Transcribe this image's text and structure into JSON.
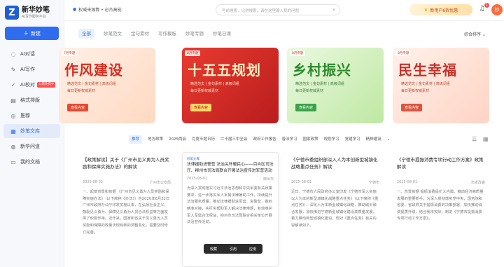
{
  "app": {
    "logo_mark": "Z",
    "title": "新华妙笔",
    "subtitle": "AI写作服务平台"
  },
  "sidebar": {
    "new_button": "新建",
    "items": [
      {
        "label": "AI对话",
        "icon": "chat-icon"
      },
      {
        "label": "AI写作",
        "icon": "pen-icon"
      },
      {
        "label": "AI校对",
        "icon": "proofread-icon",
        "badge": "公测免费中"
      },
      {
        "label": "格式排版",
        "icon": "format-icon"
      },
      {
        "label": "推荐",
        "icon": "recommend-icon"
      },
      {
        "label": "妙笔文库",
        "icon": "library-icon",
        "active": true
      },
      {
        "label": "新华问道",
        "icon": "ask-icon"
      },
      {
        "label": "我的文档",
        "icon": "document-icon"
      }
    ]
  },
  "topbar": {
    "tagline": "权威来源算 • 必杰高能",
    "search_placeholder": "写前搜索，记得搜索，请在这里输入我的问题",
    "promo": "新用户6折优惠",
    "notification_count": "1",
    "avatar_text": "妙"
  },
  "tabs": {
    "items": [
      "全部",
      "妙笔范文",
      "金句素材",
      "写作模板",
      "妙笔专题",
      "妙笔日课"
    ],
    "active": 0,
    "sort_label": "综合排序"
  },
  "banners": [
    {
      "tag": "7月专题",
      "title": "作风建设",
      "line1": "精选范文 | 金句素材 | 高级词组",
      "line2": "每日更新权威素材",
      "button": "查看内容"
    },
    {
      "tag": "8月专题",
      "title": "十五五规划",
      "line1": "精选范文 | 金句素材 | 高级词组",
      "line2": "每日更新权威素材",
      "button": "查看内容"
    },
    {
      "tag": "8月专题",
      "title": "乡村振兴",
      "line1": "精选范文 | 金句素材 | 高级词组",
      "line2": "每日更新权威素材",
      "button": "查看内容"
    },
    {
      "tag": "8月专题",
      "title": "民生幸福",
      "line1": "精选范文 | 金句素材 | 高级词组",
      "line2": "每日更新权威素材",
      "button": "查看内容"
    }
  ],
  "filters": {
    "items": [
      "推荐",
      "地方政策",
      "2025两会",
      "月度专题日历",
      "二十届三中全会",
      "政府工作报告",
      "普法学习",
      "国家政策",
      "规划学习",
      "党建学习",
      "精神建设"
    ],
    "active": 0
  },
  "cards": [
    {
      "title": "【政策解读】关于《广州市见义勇为人员奖励和保障实施办法》的解读",
      "date": "2025-08-02",
      "source": "广州市公安局",
      "body": "一、起草背景和依据 《广州市见义勇为人员奖励和保障实施办法》（以下简称《办法》）自2020年6月22日广州市政府办公厅印发实施以来，在弘扬社会正义、鼓励见义勇为、保障见义勇为人员合法权益等方面发挥了积极作用。近年来，国家和省关于见义勇为人员奖励和保障的政策法规有新的调整变化，需要及时修订完善。"
    },
    {
      "tag": "妙笔文库",
      "title": "法律援助进警营 法治关怀暖民心——百合区司法厅、柳州市司法局联合开展法治宣传进军营活动",
      "date": "2025-08-01",
      "source": "柳州市",
      "body": "为深入贯彻落实习近平法治思想和中央军委有关政策要求，进一步落实军人军属法律援助工作，持续提升法治服务质量，推动法律援助进军营、进警营，做到精准对接，实打实帮助军人解决法律难题，有效维护军人军属合法权益，柳州市司法局联合相关单位开展法治宣传活动。"
    },
    {
      "title": "《宁德市委组织部深入人为本创新型城镇化战略重点任务》解读",
      "date": "2025-08-01",
      "source": "宁德市",
      "body": "近日，宁德市人民政府办公室印发《宁德市深入实施以人为本的新型城镇化战略重点任务》（以下简称《重点任务》），深化人为本新型城镇化战略，推动城乡融合发展，加快推进宁德新型城镇化建设高质量发展，着力推动新型城镇化建设。现对《重点任务》有关内容解读如下。"
    },
    {
      "title": "《宁德市提振消费专项行动工作方案》政策解读",
      "date": "2025-08-01",
      "source": "市发改委",
      "body": "一、背景依据 提振消费是扩大内需、推动经济高质量发展的重要抓手。为深入贯彻落实党中央、国务院和省委、省政府关于提振消费的决策部署，加快推动消费提质升级，结合我市实际，制定《宁德市提振消费专项行动工作方案》。"
    }
  ],
  "card_actions": [
    "收藏",
    "引用",
    "应用"
  ]
}
